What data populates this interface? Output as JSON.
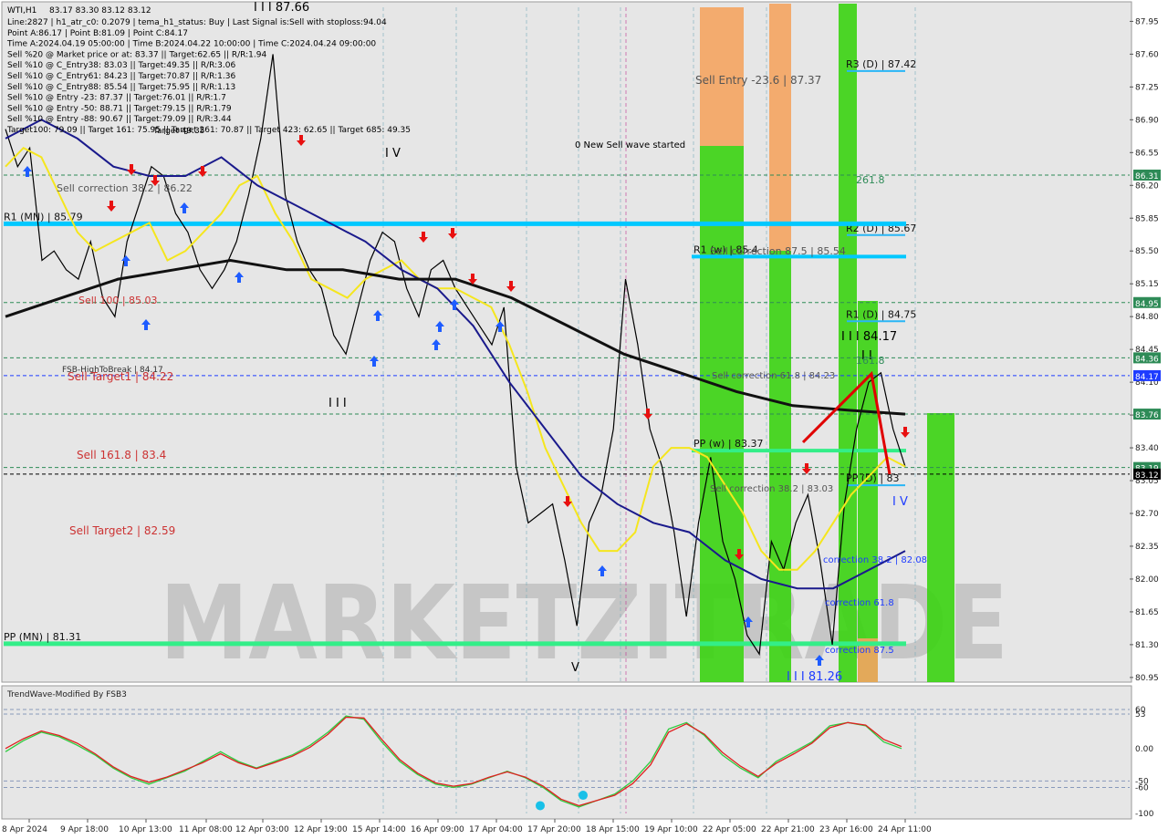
{
  "chart_data": [
    {
      "type": "line",
      "symbol": "WTI,H1",
      "ohlc_header": "83.17 83.30 83.12 83.12",
      "info_lines": [
        "Line:2827 | h1_atr_c0: 0.2079 | tema_h1_status: Buy | Last Signal is:Sell with stoploss:94.04",
        "Point A:86.17 | Point B:81.09 | Point C:84.17",
        "Time A:2024.04.19 05:00:00 | Time B:2024.04.22 10:00:00 | Time C:2024.04.24 09:00:00",
        "Sell %20 @ Market price or at: 83.37 || Target:62.65 || R/R:1.94",
        "Sell %10 @ C_Entry38: 83.03 || Target:49.35 || R/R:3.06",
        "Sell %10 @ C_Entry61: 84.23 || Target:70.87 || R/R:1.36",
        "Sell %10 @ C_Entry88: 85.54 || Target:75.95 || R/R:1.13",
        "Sell %10 @ Entry -23: 87.37 || Target:76.01 || R/R:1.7",
        "Sell %10 @ Entry -50: 88.71 || Target:79.15 || R/R:1.79",
        "Sell %10 @ Entry -88: 90.67 || Target:79.09 || R/R:3.44",
        "Target100: 79.09 || Target 161: 75.95 || Target 261: 70.87 || Target 423: 62.65 || Target 685: 49.35"
      ],
      "yaxis_labels": [
        "87.95",
        "87.60",
        "87.25",
        "86.90",
        "86.55",
        "86.20",
        "85.85",
        "85.50",
        "85.15",
        "84.80",
        "84.45",
        "84.10",
        "83.75",
        "83.40",
        "83.05",
        "82.70",
        "82.35",
        "82.00",
        "81.65",
        "81.30",
        "80.95"
      ],
      "ylim": [
        80.9,
        88.1
      ],
      "xaxis_labels": [
        "8 Apr 2024",
        "9 Apr 18:00",
        "10 Apr 13:00",
        "11 Apr 08:00",
        "12 Apr 03:00",
        "12 Apr 19:00",
        "15 Apr 14:00",
        "16 Apr 09:00",
        "17 Apr 04:00",
        "17 Apr 20:00",
        "18 Apr 15:00",
        "19 Apr 10:00",
        "22 Apr 05:00",
        "22 Apr 21:00",
        "23 Apr 16:00",
        "24 Apr 11:00"
      ],
      "price_tags": [
        {
          "label": "86.31",
          "value": 86.31,
          "color": "#2e8b57"
        },
        {
          "label": "84.95",
          "value": 84.95,
          "color": "#2e8b57"
        },
        {
          "label": "84.36",
          "value": 84.36,
          "color": "#2e8b57"
        },
        {
          "label": "84.17",
          "value": 84.17,
          "color": "#1e3cff"
        },
        {
          "label": "83.76",
          "value": 83.76,
          "color": "#2e8b57"
        },
        {
          "label": "83.19",
          "value": 83.19,
          "color": "#2e8b57"
        },
        {
          "label": "83.12",
          "value": 83.12,
          "color": "#000000"
        }
      ],
      "levels": [
        {
          "label": "R3 (D) | 87.42",
          "value": 87.42,
          "color": "#29b6f6"
        },
        {
          "label": "R2 (D) | 85.67",
          "value": 85.67,
          "color": "#29b6f6"
        },
        {
          "label": "R1 (D) | 84.75",
          "value": 84.75,
          "color": "#29b6f6"
        },
        {
          "label": "PP (D) | 83",
          "value": 83.0,
          "color": "#29b6f6"
        },
        {
          "label": "R1 (MN) | 85.79",
          "value": 85.79,
          "color": "#00c8ff"
        },
        {
          "label": "R1 (w) | 85.4",
          "value": 85.44,
          "color": "#00c8ff"
        },
        {
          "label": "PP (w) | 83.37",
          "value": 83.37,
          "color": "#33ee88"
        },
        {
          "label": "PP (MN) | 81.31",
          "value": 81.31,
          "color": "#33ee88"
        }
      ],
      "annotations": [
        {
          "label": "I I I 87.66",
          "color": "#000000"
        },
        {
          "label": "I V",
          "color": "#000000"
        },
        {
          "label": "I I I",
          "color": "#000000"
        },
        {
          "label": "V",
          "color": "#000000"
        },
        {
          "label": "I I I 84.17",
          "color": "#000000"
        },
        {
          "label": "I I",
          "color": "#000000"
        },
        {
          "label": "I V",
          "color": "#1e3cff"
        },
        {
          "label": "I I I 81.26",
          "color": "#1e3cff"
        },
        {
          "label": "0 New Sell wave started",
          "color": "#000000"
        },
        {
          "label": "Sell Entry -23.6 | 87.37",
          "color": "#555555"
        },
        {
          "label": "261.8",
          "color": "#2e8b57"
        },
        {
          "label": "161.8",
          "color": "#2e8b57"
        },
        {
          "label": "Sell correction 38.2 | 86.22",
          "color": "#555555"
        },
        {
          "label": "Sell correction 87.5 | 85.54",
          "color": "#555555"
        },
        {
          "label": "Sell correction 61.8 | 84.23",
          "color": "#555555"
        },
        {
          "label": "Sell correction 38.2 | 83.03",
          "color": "#555555"
        },
        {
          "label": "Sell 100 | 85.03",
          "color": "#cc3333"
        },
        {
          "label": "FSB-HighToBreak | 84.17",
          "color": "#333333"
        },
        {
          "label": "Sell Target1 | 84.22",
          "color": "#cc3333"
        },
        {
          "label": "Sell 161.8 | 83.4",
          "color": "#cc3333"
        },
        {
          "label": "Sell Target2 | 82.59",
          "color": "#cc3333"
        },
        {
          "label": "correction 38.2 | 82.08",
          "color": "#1e3cff"
        },
        {
          "label": "correction 61.8",
          "color": "#1e3cff"
        },
        {
          "label": "correction 87.5",
          "color": "#1e3cff"
        },
        {
          "label": "Target 49.35",
          "color": "#000000"
        }
      ],
      "watermark": "MARKETZITRADE",
      "series": [
        {
          "name": "price",
          "color": "#000000",
          "values": [
            86.8,
            86.4,
            86.6,
            85.4,
            85.5,
            85.3,
            85.2,
            85.6,
            85.0,
            84.8,
            85.6,
            86.0,
            86.4,
            86.3,
            85.9,
            85.7,
            85.3,
            85.1,
            85.3,
            85.6,
            86.1,
            86.7,
            87.6,
            86.1,
            85.6,
            85.3,
            85.1,
            84.6,
            84.4,
            84.9,
            85.4,
            85.7,
            85.6,
            85.1,
            84.8,
            85.3,
            85.4,
            85.1,
            84.9,
            84.7,
            84.5,
            84.9,
            83.2,
            82.6,
            82.7,
            82.8,
            82.2,
            81.5,
            82.6,
            82.9,
            83.6,
            85.2,
            84.5,
            83.6,
            83.2,
            82.5,
            81.6,
            82.6,
            83.3,
            82.4,
            82.0,
            81.4,
            81.2,
            82.4,
            82.1,
            82.6,
            82.9,
            82.2,
            81.3,
            82.8,
            83.6,
            84.1,
            84.2,
            83.6,
            83.2
          ]
        },
        {
          "name": "ma-yellow",
          "color": "#f5e61e",
          "values": [
            86.4,
            86.6,
            86.5,
            86.1,
            85.7,
            85.5,
            85.6,
            85.7,
            85.8,
            85.4,
            85.5,
            85.7,
            85.9,
            86.2,
            86.3,
            85.9,
            85.6,
            85.2,
            85.1,
            85.0,
            85.2,
            85.3,
            85.4,
            85.2,
            85.1,
            85.1,
            85.0,
            84.9,
            84.5,
            84.0,
            83.4,
            83.0,
            82.6,
            82.3,
            82.3,
            82.5,
            83.2,
            83.4,
            83.4,
            83.3,
            83.0,
            82.7,
            82.3,
            82.1,
            82.1,
            82.3,
            82.6,
            82.9,
            83.1,
            83.3,
            83.2
          ]
        },
        {
          "name": "ma-navy",
          "color": "#1a1a8c",
          "values": [
            86.7,
            86.9,
            86.7,
            86.4,
            86.3,
            86.3,
            86.5,
            86.2,
            86.0,
            85.8,
            85.6,
            85.3,
            85.1,
            84.7,
            84.1,
            83.6,
            83.1,
            82.8,
            82.6,
            82.5,
            82.2,
            82.0,
            81.9,
            81.9,
            82.1,
            82.3
          ]
        },
        {
          "name": "ma-black",
          "color": "#111111",
          "values": [
            84.8,
            85.0,
            85.2,
            85.3,
            85.4,
            85.3,
            85.3,
            85.2,
            85.2,
            85.0,
            84.7,
            84.4,
            84.2,
            84.0,
            83.85,
            83.8,
            83.76
          ]
        }
      ]
    },
    {
      "type": "line",
      "title": "TrendWave-Modified By FSB3",
      "ylim": [
        -100,
        60
      ],
      "yaxis_labels": [
        "60",
        "53",
        "0.00",
        "-50",
        "-60",
        "-100"
      ],
      "series": [
        {
          "name": "green",
          "color": "#2ecc40",
          "values": [
            -5,
            12,
            25,
            18,
            5,
            -10,
            -30,
            -45,
            -55,
            -45,
            -35,
            -20,
            -5,
            -20,
            -30,
            -20,
            -10,
            5,
            25,
            50,
            45,
            10,
            -20,
            -40,
            -55,
            -60,
            -55,
            -45,
            -35,
            -45,
            -60,
            -80,
            -90,
            -80,
            -70,
            -50,
            -20,
            30,
            40,
            20,
            -10,
            -30,
            -45,
            -20,
            -5,
            10,
            35,
            40,
            35,
            10,
            0
          ]
        },
        {
          "name": "red",
          "color": "#e02020",
          "values": [
            0,
            15,
            27,
            20,
            8,
            -8,
            -28,
            -43,
            -52,
            -44,
            -33,
            -22,
            -8,
            -22,
            -31,
            -22,
            -12,
            2,
            22,
            48,
            47,
            14,
            -17,
            -38,
            -53,
            -58,
            -54,
            -44,
            -36,
            -44,
            -58,
            -78,
            -88,
            -80,
            -72,
            -54,
            -25,
            25,
            38,
            22,
            -6,
            -27,
            -43,
            -23,
            -8,
            8,
            32,
            40,
            36,
            14,
            3
          ]
        }
      ]
    }
  ],
  "colors": {
    "background": "#e4e4e4",
    "green_bar": "#3ad311",
    "orange_bar": "#f4a460",
    "cyan_line": "#00c8ff",
    "spring_line": "#33ee88",
    "red_level": "#cc3333"
  }
}
